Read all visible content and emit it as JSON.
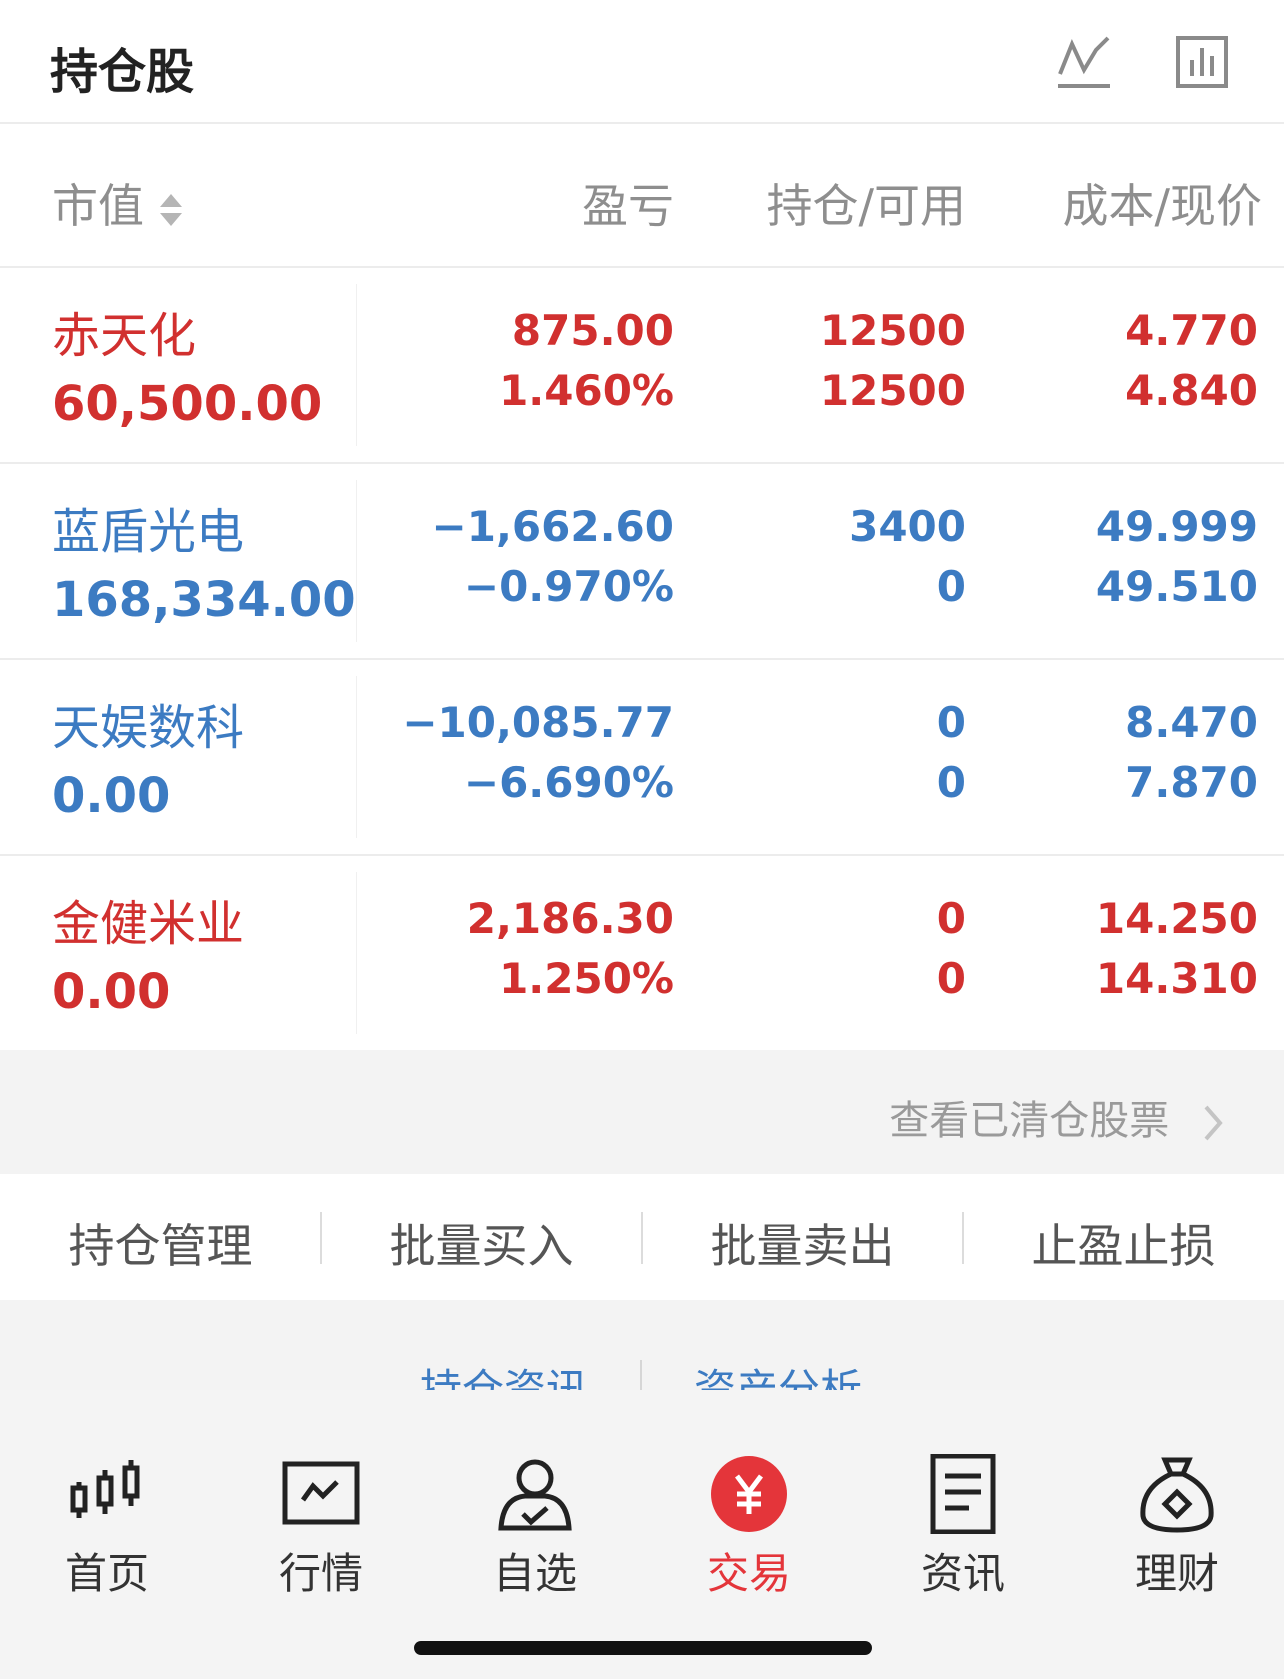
{
  "header": {
    "title": "持仓股",
    "icons": [
      "trend-chart-icon",
      "bar-chart-icon"
    ]
  },
  "columns": {
    "market_value": "市值",
    "pnl": "盈亏",
    "position": "持仓/可用",
    "cost_price": "成本/现价"
  },
  "holdings": [
    {
      "name": "赤天化",
      "market_value": "60,500.00",
      "pnl": "875.00",
      "pnl_pct": "1.460%",
      "holding": "12500",
      "available": "12500",
      "cost": "4.770",
      "price": "4.840",
      "color": "#d1302f"
    },
    {
      "name": "蓝盾光电",
      "market_value": "168,334.00",
      "pnl": "−1,662.60",
      "pnl_pct": "−0.970%",
      "holding": "3400",
      "available": "0",
      "cost": "49.999",
      "price": "49.510",
      "color": "#3c7bc2"
    },
    {
      "name": "天娱数科",
      "market_value": "0.00",
      "pnl": "−10,085.77",
      "pnl_pct": "−6.690%",
      "holding": "0",
      "available": "0",
      "cost": "8.470",
      "price": "7.870",
      "color": "#3c7bc2"
    },
    {
      "name": "金健米业",
      "market_value": "0.00",
      "pnl": "2,186.30",
      "pnl_pct": "1.250%",
      "holding": "0",
      "available": "0",
      "cost": "14.250",
      "price": "14.310",
      "color": "#d1302f"
    }
  ],
  "cleared_link": "查看已清仓股票",
  "actions": [
    "持仓管理",
    "批量买入",
    "批量卖出",
    "止盈止损"
  ],
  "sub_links": [
    "持仓资讯",
    "资产分析"
  ],
  "tabbar": [
    {
      "label": "首页",
      "icon": "candlestick-icon"
    },
    {
      "label": "行情",
      "icon": "market-chart-icon"
    },
    {
      "label": "自选",
      "icon": "user-check-icon"
    },
    {
      "label": "交易",
      "icon": "yuan-circle-icon",
      "active": true
    },
    {
      "label": "资讯",
      "icon": "document-icon"
    },
    {
      "label": "理财",
      "icon": "money-bag-icon"
    }
  ],
  "colors": {
    "up": "#d1302f",
    "down": "#3c7bc2",
    "active_tab": "#e4353a"
  }
}
